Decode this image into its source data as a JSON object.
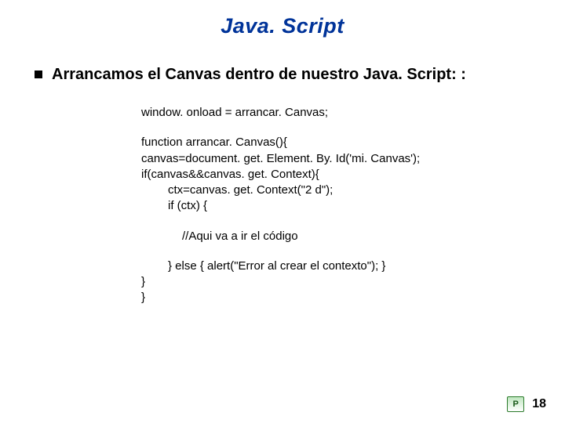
{
  "title": "Java. Script",
  "bullet": "Arrancamos el Canvas dentro de nuestro Java. Script: :",
  "code": {
    "l1": "window. onload = arrancar. Canvas;",
    "l2": "function arrancar. Canvas(){",
    "l3": "canvas=document. get. Element. By. Id('mi. Canvas');",
    "l4": "if(canvas&&canvas. get. Context){",
    "l5": "ctx=canvas. get. Context(\"2 d\");",
    "l6": "if (ctx) {",
    "comment": "//Aqui va a ir el código",
    "l7": "} else { alert(\"Error al crear el contexto\"); }",
    "l8": "}",
    "l9": "}"
  },
  "page_number": "18"
}
